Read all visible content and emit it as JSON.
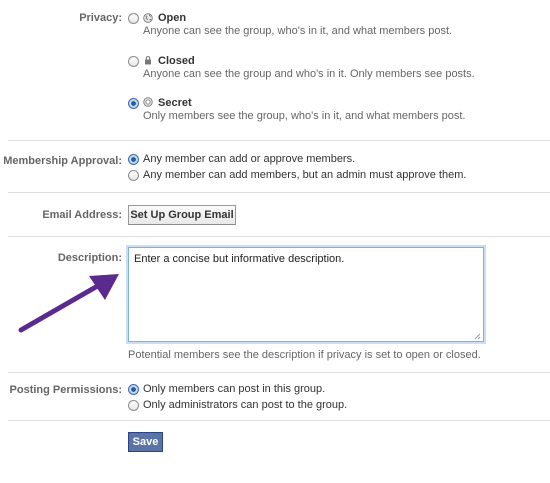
{
  "privacy": {
    "label": "Privacy:",
    "options": [
      {
        "title": "Open",
        "description": "Anyone can see the group, who's in it, and what members post.",
        "icon": "globe-icon",
        "selected": false
      },
      {
        "title": "Closed",
        "description": "Anyone can see the group and who's in it. Only members see posts.",
        "icon": "lock-icon",
        "selected": false
      },
      {
        "title": "Secret",
        "description": "Only members see the group, who's in it, and what members post.",
        "icon": "circle-icon",
        "selected": true
      }
    ]
  },
  "membership": {
    "label": "Membership Approval:",
    "options": [
      {
        "text": "Any member can add or approve members.",
        "selected": true
      },
      {
        "text": "Any member can add members, but an admin must approve them.",
        "selected": false
      }
    ]
  },
  "email": {
    "label": "Email Address:",
    "button_label": "Set Up Group Email"
  },
  "description": {
    "label": "Description:",
    "value": "Enter a concise but informative description.",
    "hint": "Potential members see the description if privacy is set to open or closed."
  },
  "posting": {
    "label": "Posting Permissions:",
    "options": [
      {
        "text": "Only members can post in this group.",
        "selected": true
      },
      {
        "text": "Only administrators can post to the group.",
        "selected": false
      }
    ]
  },
  "save_label": "Save",
  "colors": {
    "accent": "#5b74a8",
    "focus": "#7fb0e0",
    "arrow": "#5a2a8f"
  }
}
